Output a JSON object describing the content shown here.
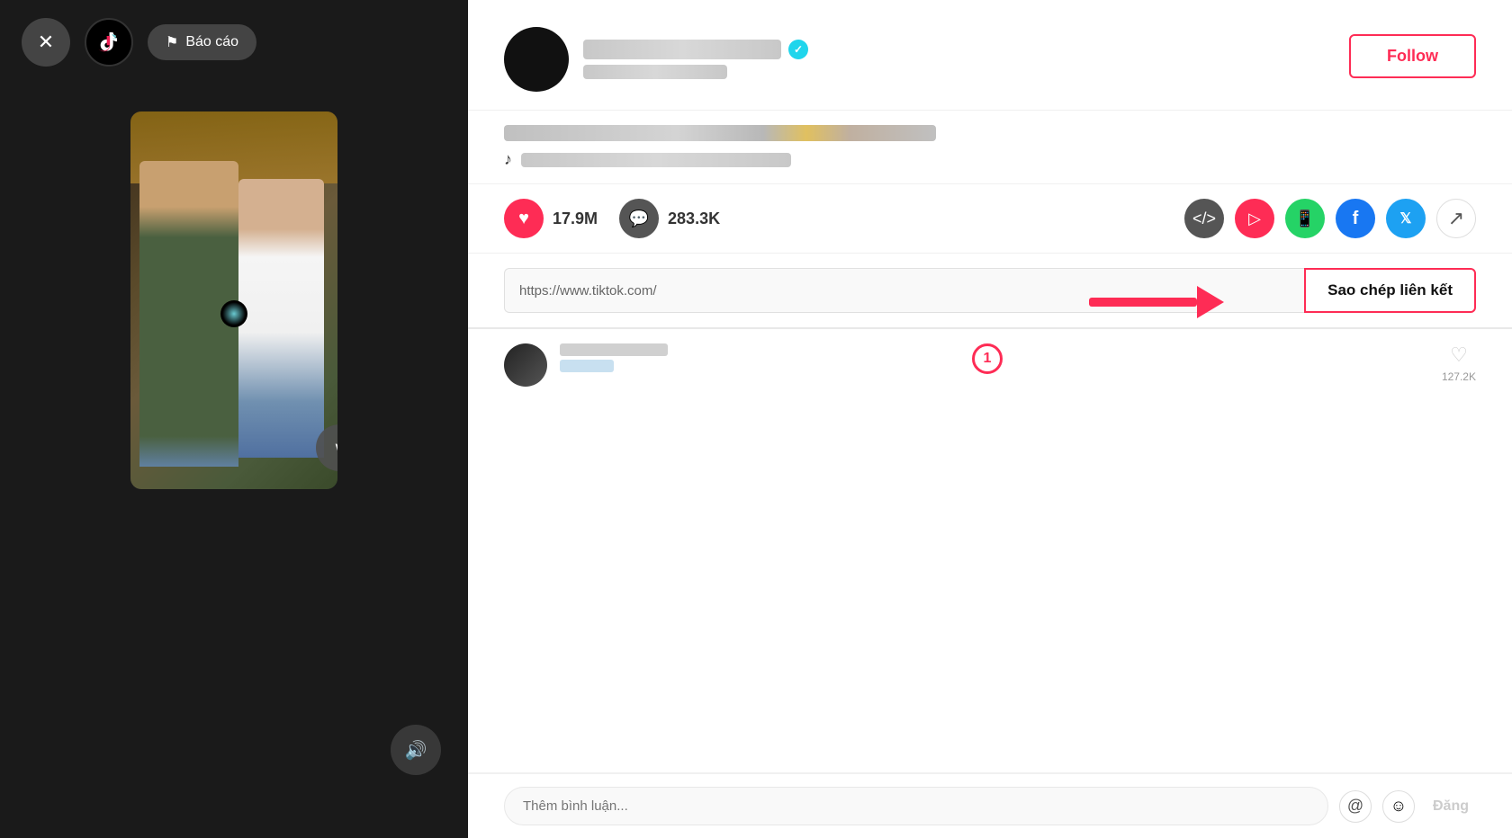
{
  "left_panel": {
    "close_button_label": "✕",
    "report_button_label": "Báo cáo",
    "volume_button_label": "🔊",
    "scroll_down_label": "∨"
  },
  "right_panel": {
    "profile": {
      "username_placeholder": "blurred username",
      "verified": true,
      "display_name_placeholder": "blurred display name",
      "follow_button_label": "Follow"
    },
    "caption": {
      "text_placeholder": "blurred caption text with emoji",
      "music_placeholder": "blurred music name"
    },
    "stats": {
      "likes": "17.9M",
      "comments": "283.3K"
    },
    "share_icons": [
      {
        "name": "embed",
        "label": "</>"
      },
      {
        "name": "direct",
        "label": "▷"
      },
      {
        "name": "whatsapp",
        "label": "W"
      },
      {
        "name": "facebook",
        "label": "f"
      },
      {
        "name": "twitter",
        "label": "t"
      },
      {
        "name": "more",
        "label": "↗"
      }
    ],
    "link": {
      "url": "https://www.tiktok.com/",
      "copy_button_label": "Sao chép liên kết"
    },
    "annotation": {
      "step_number": "1",
      "arrow_color": "#fe2c55"
    },
    "comment_input": {
      "placeholder": "Thêm bình luận...",
      "at_label": "@",
      "emoji_label": "☺",
      "post_label": "Đăng"
    },
    "comment": {
      "count": "127.2K"
    }
  }
}
